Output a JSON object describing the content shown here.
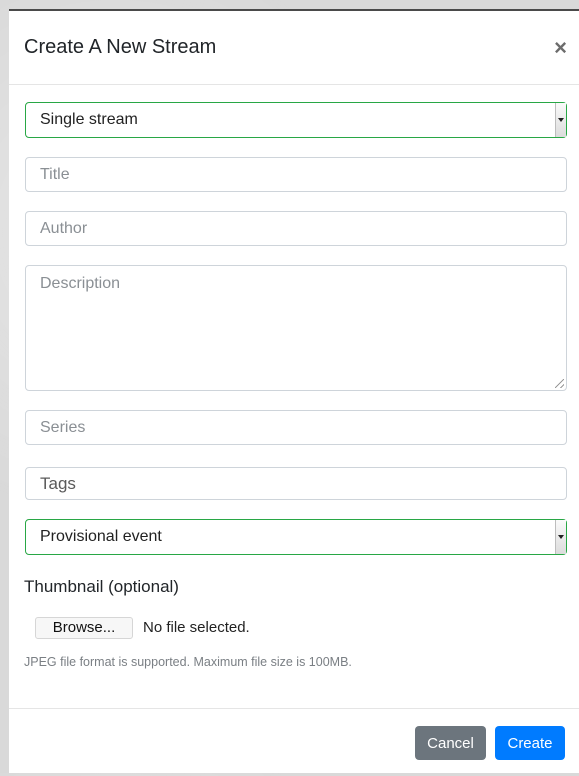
{
  "modal": {
    "title": "Create A New Stream",
    "close_symbol": "×"
  },
  "form": {
    "stream_type": {
      "selected": "Single stream"
    },
    "title_field": {
      "placeholder": "Title"
    },
    "author_field": {
      "placeholder": "Author"
    },
    "description_field": {
      "placeholder": "Description"
    },
    "series_field": {
      "placeholder": "Series"
    },
    "tags_field": {
      "placeholder": "Tags"
    },
    "event_type": {
      "selected": "Provisional event"
    },
    "thumbnail": {
      "label": "Thumbnail (optional)",
      "browse_label": "Browse...",
      "status": "No file selected.",
      "help": "JPEG file format is supported. Maximum file size is 100MB."
    }
  },
  "footer": {
    "cancel_label": "Cancel",
    "create_label": "Create"
  },
  "colors": {
    "select_border": "#28a745",
    "cancel_bg": "#6c757d",
    "create_bg": "#007bff"
  },
  "icons": {
    "close": "close-icon",
    "dropdown": "chevron-down-icon",
    "resize": "resize-handle-icon"
  }
}
